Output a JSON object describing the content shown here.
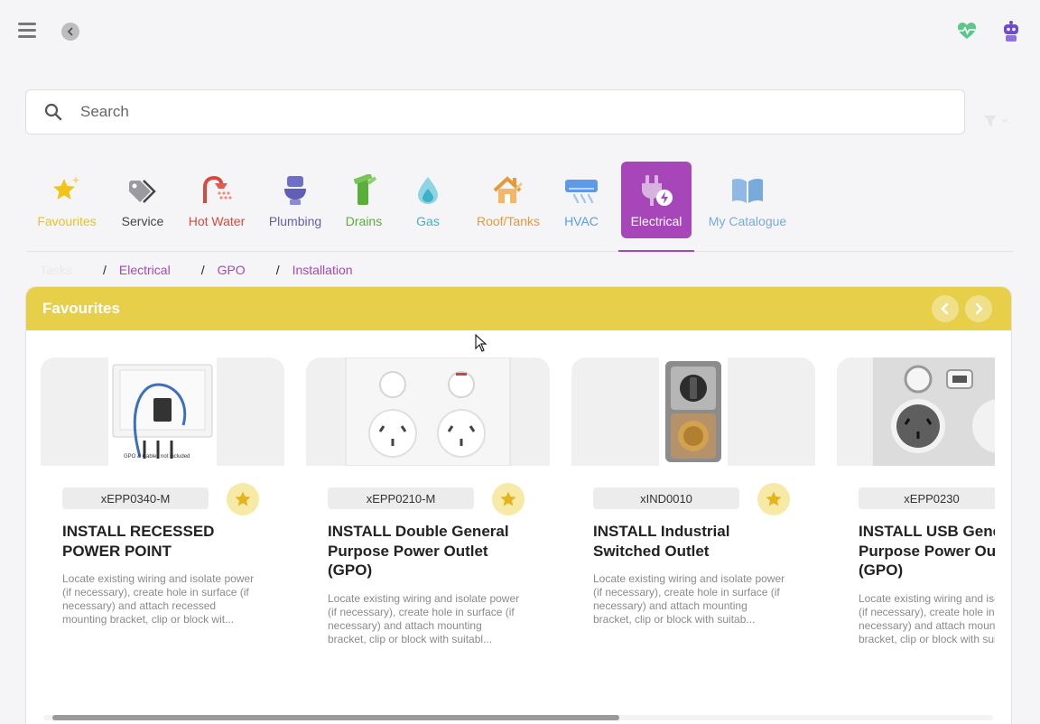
{
  "topbar": {
    "menu_icon": "hamburger-menu-icon",
    "back_icon": "chevron-left-icon",
    "health_icon": "heart-pulse-icon",
    "assistant_icon": "robot-icon"
  },
  "search": {
    "placeholder": "Search",
    "value": ""
  },
  "categories": [
    {
      "label": "Favourites",
      "icon": "star-sparkle-icon",
      "color": "#e8c41f"
    },
    {
      "label": "Service",
      "icon": "tags-icon",
      "color": "#444444"
    },
    {
      "label": "Hot Water",
      "icon": "shower-icon",
      "color": "#d9483b"
    },
    {
      "label": "Plumbing",
      "icon": "toilet-icon",
      "color": "#5e5fb5"
    },
    {
      "label": "Drains",
      "icon": "pipe-icon",
      "color": "#5aae3a"
    },
    {
      "label": "Gas",
      "icon": "flame-drop-icon",
      "color": "#3bb2c9"
    },
    {
      "label": "Roof/Tanks",
      "icon": "house-icon",
      "color": "#e59a3a"
    },
    {
      "label": "HVAC",
      "icon": "air-conditioner-icon",
      "color": "#5d9be8"
    },
    {
      "label": "Electrical",
      "icon": "plug-icon",
      "color": "#ffffff",
      "active": true
    },
    {
      "label": "My Catalogue",
      "icon": "book-icon",
      "color": "#78aadb"
    }
  ],
  "breadcrumb": [
    "Tasks",
    "Electrical",
    "GPO",
    "Installation"
  ],
  "favourites": {
    "title": "Favourites",
    "cards": [
      {
        "code": "xEPP0340-M",
        "title": "INSTALL RECESSED POWER POINT",
        "description": "Locate existing wiring and isolate power (if necessary), create hole in surface (if necessary) and attach recessed mounting bracket, clip or block wit...",
        "image_caption": "GPO & Cables not included"
      },
      {
        "code": "xEPP0210-M",
        "title": "INSTALL Double General Purpose Power Outlet (GPO)",
        "description": "Locate existing wiring and isolate power (if necessary), create hole in surface (if necessary) and attach mounting bracket, clip or block with suitabl..."
      },
      {
        "code": "xIND0010",
        "title": "INSTALL Industrial Switched Outlet",
        "description": "Locate existing wiring and isolate power (if necessary), create hole in surface (if necessary) and attach mounting bracket, clip or block with suitab..."
      },
      {
        "code": "xEPP0230",
        "title": "INSTALL USB General Purpose Power Outlet (GPO)",
        "description": "Locate existing wiring and isolate power (if necessary), create hole in surface (if necessary) and attach mounting bracket, clip or block with suitabl..."
      }
    ]
  },
  "colors": {
    "accent": "#a646b9",
    "favourites_bar": "#e8cf4a",
    "star_bg": "#f7e9a6",
    "star": "#e2b51f"
  }
}
